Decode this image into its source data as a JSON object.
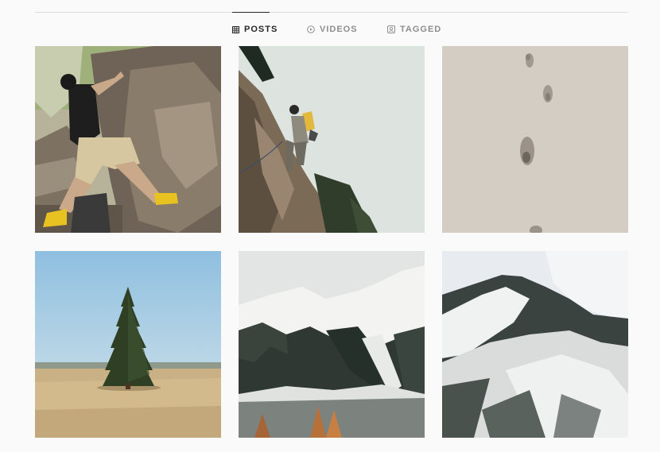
{
  "tabs": [
    {
      "label": "POSTS",
      "icon": "grid-icon",
      "active": true
    },
    {
      "label": "VIDEOS",
      "icon": "play-circle-icon",
      "active": false
    },
    {
      "label": "TAGGED",
      "icon": "tag-person-icon",
      "active": false
    }
  ],
  "posts": [
    {
      "subject": "climber-bouldering"
    },
    {
      "subject": "climber-on-cliff"
    },
    {
      "subject": "footprints-in-snow"
    },
    {
      "subject": "lone-pine-tree"
    },
    {
      "subject": "snowy-mountain-ridge"
    },
    {
      "subject": "snowy-mountain-peak"
    }
  ],
  "colors": {
    "background": "#fafafa",
    "active_tab": "#262626",
    "inactive_tab": "#8e8e8e",
    "divider": "#dbdbdb"
  }
}
